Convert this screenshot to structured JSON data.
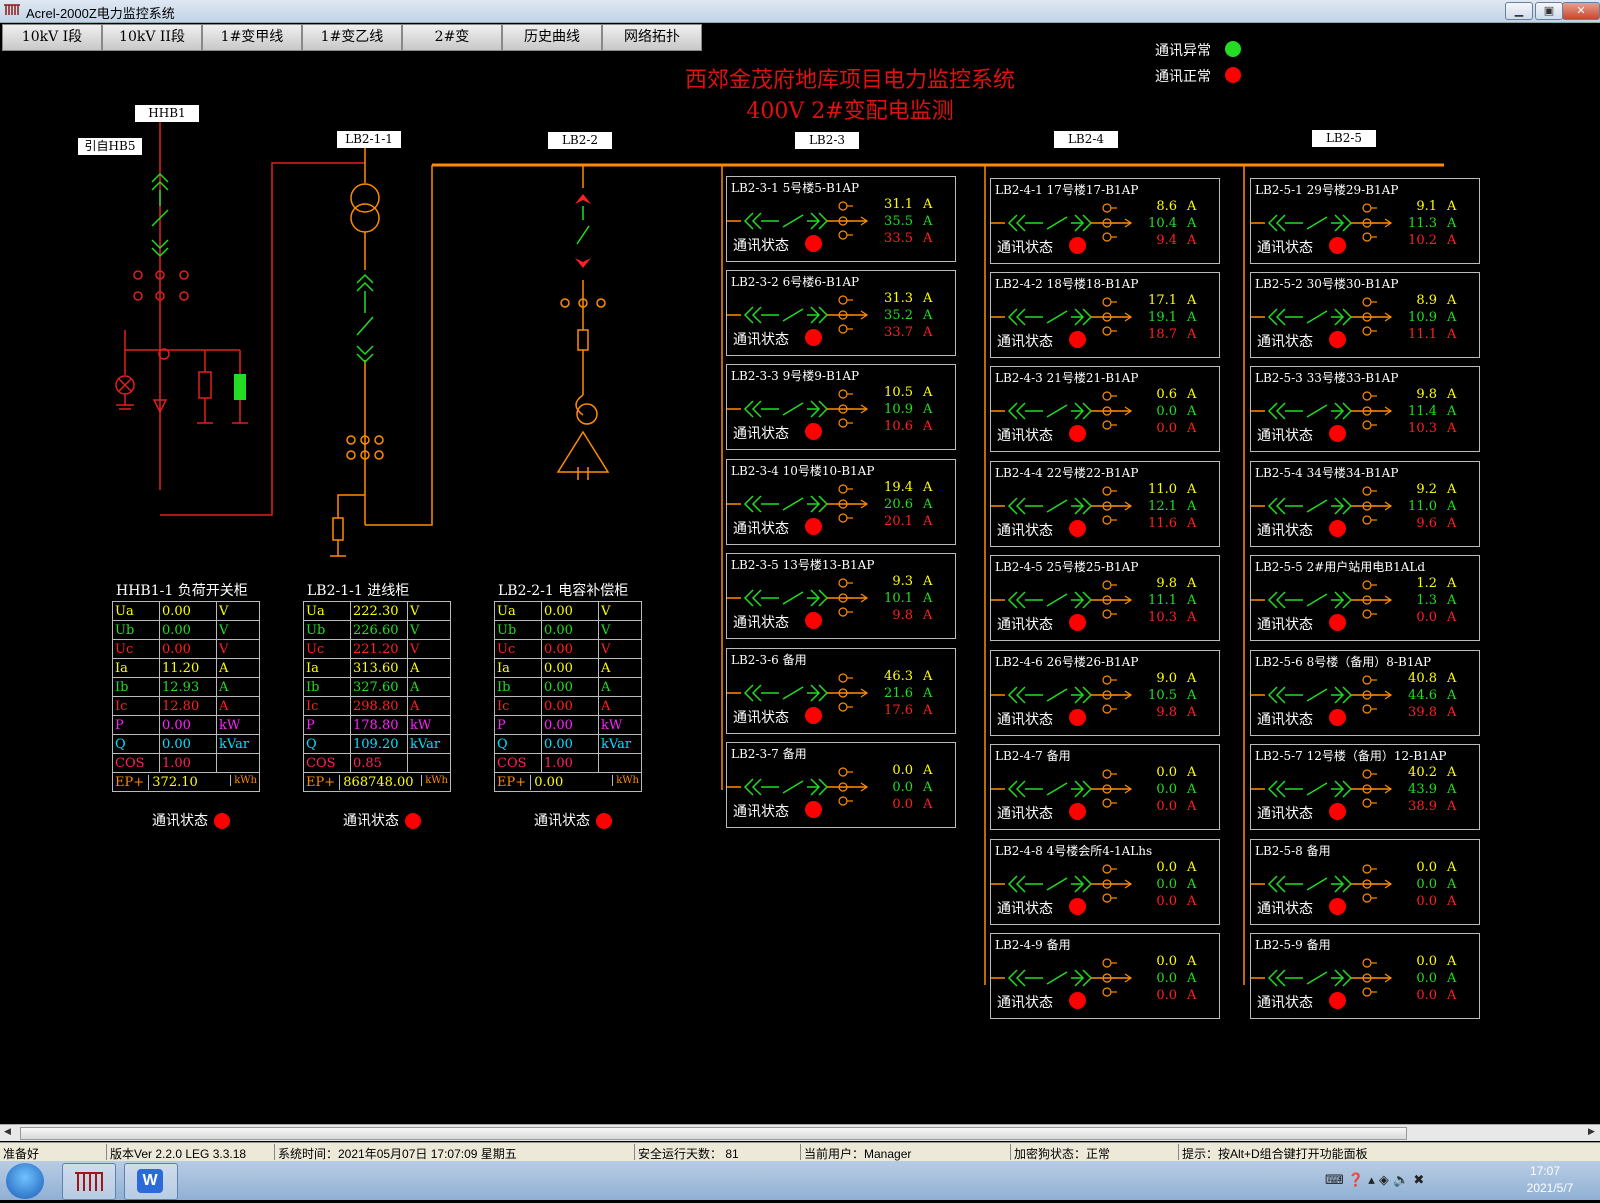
{
  "window": {
    "title": "Acrel-2000Z电力监控系统",
    "btn_min": "▁",
    "btn_max": "▣",
    "btn_close": "✕"
  },
  "nav": [
    "10kV  I段",
    "10kV  II段",
    "1#变甲线",
    "1#变乙线",
    "2#变",
    "历史曲线",
    "网络拓扑"
  ],
  "header": {
    "title1": "西郊金茂府地库项目电力监控系统",
    "title2": "400V  2#变配电监测"
  },
  "legend": {
    "abnormal": "通讯异常",
    "normal": "通讯正常",
    "abnormal_color": "#22dd22",
    "normal_color": "#ff0000"
  },
  "labels": {
    "hhb1": "HHB1",
    "from_hb5": "引自HB5",
    "lb211": "LB2-1-1",
    "lb22": "LB2-2",
    "lb23": "LB2-3",
    "lb24": "LB2-4",
    "lb25": "LB2-5"
  },
  "status_label": "通讯状态",
  "unit_A": "A",
  "meters": [
    {
      "title": "HHB1-1 负荷开关柜",
      "rows": [
        [
          "Ua",
          "0.00",
          "V"
        ],
        [
          "Ub",
          "0.00",
          "V"
        ],
        [
          "Uc",
          "0.00",
          "V"
        ],
        [
          "Ia",
          "11.20",
          "A"
        ],
        [
          "Ib",
          "12.93",
          "A"
        ],
        [
          "Ic",
          "12.80",
          "A"
        ],
        [
          "P",
          "0.00",
          "kW"
        ],
        [
          "Q",
          "0.00",
          "kVar"
        ],
        [
          "COS",
          "1.00",
          ""
        ]
      ],
      "ep_label": "EP+",
      "ep_value": "372.10",
      "ep_unit": "kWh"
    },
    {
      "title": "LB2-1-1 进线柜",
      "rows": [
        [
          "Ua",
          "222.30",
          "V"
        ],
        [
          "Ub",
          "226.60",
          "V"
        ],
        [
          "Uc",
          "221.20",
          "V"
        ],
        [
          "Ia",
          "313.60",
          "A"
        ],
        [
          "Ib",
          "327.60",
          "A"
        ],
        [
          "Ic",
          "298.80",
          "A"
        ],
        [
          "P",
          "178.80",
          "kW"
        ],
        [
          "Q",
          "109.20",
          "kVar"
        ],
        [
          "COS",
          "0.85",
          ""
        ]
      ],
      "ep_label": "EP+",
      "ep_value": "868748.00",
      "ep_unit": "kWh"
    },
    {
      "title": "LB2-2-1 电容补偿柜",
      "rows": [
        [
          "Ua",
          "0.00",
          "V"
        ],
        [
          "Ub",
          "0.00",
          "V"
        ],
        [
          "Uc",
          "0.00",
          "V"
        ],
        [
          "Ia",
          "0.00",
          "A"
        ],
        [
          "Ib",
          "0.00",
          "A"
        ],
        [
          "Ic",
          "0.00",
          "A"
        ],
        [
          "P",
          "0.00",
          "kW"
        ],
        [
          "Q",
          "0.00",
          "kVar"
        ],
        [
          "COS",
          "1.00",
          ""
        ]
      ],
      "ep_label": "EP+",
      "ep_value": "0.00",
      "ep_unit": "kWh"
    }
  ],
  "feeders": {
    "lb23": [
      {
        "name": "LB2-3-1 5号楼5-B1AP",
        "a": "31.1",
        "b": "35.5",
        "c": "33.5"
      },
      {
        "name": "LB2-3-2 6号楼6-B1AP",
        "a": "31.3",
        "b": "35.2",
        "c": "33.7"
      },
      {
        "name": "LB2-3-3 9号楼9-B1AP",
        "a": "10.5",
        "b": "10.9",
        "c": "10.6"
      },
      {
        "name": "LB2-3-4 10号楼10-B1AP",
        "a": "19.4",
        "b": "20.6",
        "c": "20.1"
      },
      {
        "name": "LB2-3-5 13号楼13-B1AP",
        "a": "9.3",
        "b": "10.1",
        "c": "9.8"
      },
      {
        "name": "LB2-3-6 备用",
        "a": "46.3",
        "b": "21.6",
        "c": "17.6"
      },
      {
        "name": "LB2-3-7 备用",
        "a": "0.0",
        "b": "0.0",
        "c": "0.0"
      }
    ],
    "lb24": [
      {
        "name": "LB2-4-1 17号楼17-B1AP",
        "a": "8.6",
        "b": "10.4",
        "c": "9.4"
      },
      {
        "name": "LB2-4-2 18号楼18-B1AP",
        "a": "17.1",
        "b": "19.1",
        "c": "18.7"
      },
      {
        "name": "LB2-4-3 21号楼21-B1AP",
        "a": "0.6",
        "b": "0.0",
        "c": "0.0"
      },
      {
        "name": "LB2-4-4 22号楼22-B1AP",
        "a": "11.0",
        "b": "12.1",
        "c": "11.6"
      },
      {
        "name": "LB2-4-5 25号楼25-B1AP",
        "a": "9.8",
        "b": "11.1",
        "c": "10.3"
      },
      {
        "name": "LB2-4-6 26号楼26-B1AP",
        "a": "9.0",
        "b": "10.5",
        "c": "9.8"
      },
      {
        "name": "LB2-4-7 备用",
        "a": "0.0",
        "b": "0.0",
        "c": "0.0"
      },
      {
        "name": "LB2-4-8 4号楼会所4-1ALhs",
        "a": "0.0",
        "b": "0.0",
        "c": "0.0"
      },
      {
        "name": "LB2-4-9 备用",
        "a": "0.0",
        "b": "0.0",
        "c": "0.0"
      }
    ],
    "lb25": [
      {
        "name": "LB2-5-1 29号楼29-B1AP",
        "a": "9.1",
        "b": "11.3",
        "c": "10.2"
      },
      {
        "name": "LB2-5-2 30号楼30-B1AP",
        "a": "8.9",
        "b": "10.9",
        "c": "11.1"
      },
      {
        "name": "LB2-5-3 33号楼33-B1AP",
        "a": "9.8",
        "b": "11.4",
        "c": "10.3"
      },
      {
        "name": "LB2-5-4 34号楼34-B1AP",
        "a": "9.2",
        "b": "11.0",
        "c": "9.6"
      },
      {
        "name": "LB2-5-5 2#用户站用电B1ALd",
        "a": "1.2",
        "b": "1.3",
        "c": "0.0"
      },
      {
        "name": "LB2-5-6 8号楼（备用）8-B1AP",
        "a": "40.8",
        "b": "44.6",
        "c": "39.8"
      },
      {
        "name": "LB2-5-7 12号楼（备用）12-B1AP",
        "a": "40.2",
        "b": "43.9",
        "c": "38.9"
      },
      {
        "name": "LB2-5-8 备用",
        "a": "0.0",
        "b": "0.0",
        "c": "0.0"
      },
      {
        "name": "LB2-5-9 备用",
        "a": "0.0",
        "b": "0.0",
        "c": "0.0"
      }
    ]
  },
  "statusbar": {
    "ready": "准备好",
    "version": "版本Ver 2.2.0 LEG 3.3.18",
    "time": "系统时间：2021年05月07日  17:07:09  星期五",
    "days": "安全运行天数：  81",
    "user": "当前用户：Manager",
    "dongle": "加密狗状态：正常",
    "hint": "提示：按Alt+D组合键打开功能面板"
  },
  "taskbar": {
    "clock_time": "17:07",
    "clock_date": "2021/5/7"
  },
  "colors": {
    "bus": "#ff8c00",
    "phaseA": "#ffff00",
    "phaseB": "#22dd22",
    "phaseC": "#ff2020",
    "line_red": "#e02020",
    "line_green": "#22dd22"
  }
}
